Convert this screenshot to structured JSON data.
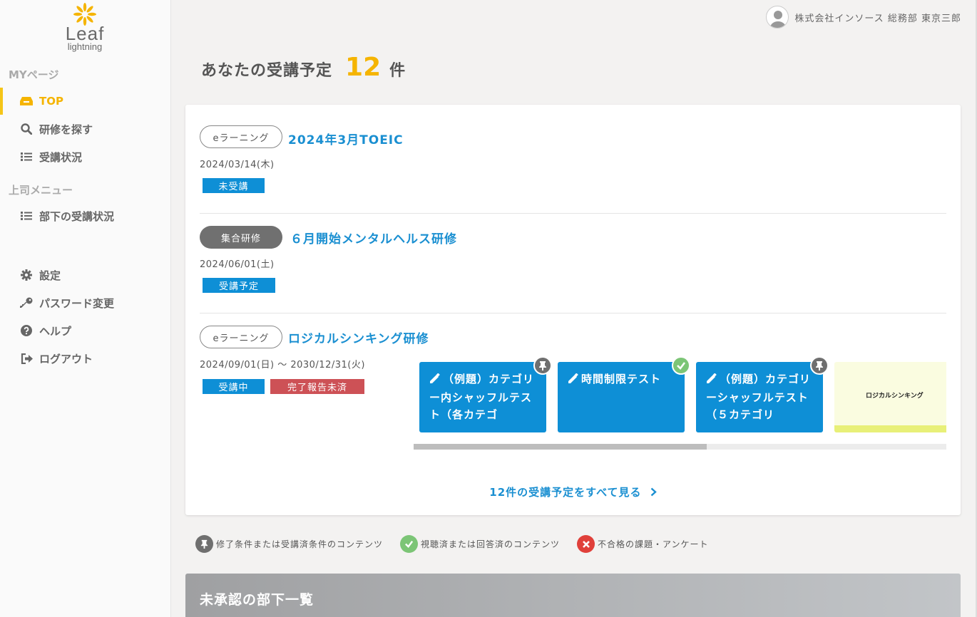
{
  "logo": {
    "name": "Leaf",
    "sub": "lightning"
  },
  "user": {
    "company": "株式会社インソース",
    "department": "総務部",
    "name": "東京三郎"
  },
  "sidebar": {
    "my_section": "MYページ",
    "my_items": [
      {
        "label": "TOP",
        "icon": "inbox-icon"
      },
      {
        "label": "研修を探す",
        "icon": "search-icon"
      },
      {
        "label": "受講状況",
        "icon": "list-icon"
      }
    ],
    "boss_section": "上司メニュー",
    "boss_items": [
      {
        "label": "部下の受講状況",
        "icon": "list-icon"
      }
    ],
    "other_items": [
      {
        "label": "設定",
        "icon": "gear-icon"
      },
      {
        "label": "パスワード変更",
        "icon": "key-icon"
      },
      {
        "label": "ヘルプ",
        "icon": "help-icon"
      },
      {
        "label": "ログアウト",
        "icon": "logout-icon"
      }
    ]
  },
  "heading": {
    "prefix": "あなたの受講予定",
    "count": "12",
    "suffix": "件"
  },
  "courses": [
    {
      "type": "eラーニング",
      "title": "2024年3月TOEIC",
      "date": "2024/03/14(木)",
      "badges": [
        "未受講"
      ]
    },
    {
      "type": "集合研修",
      "title": "６月開始メンタルヘルス研修",
      "date": "2024/06/01(土)",
      "badges": [
        "受講予定"
      ]
    },
    {
      "type": "eラーニング",
      "title": "ロジカルシンキング研修",
      "date": "2024/09/01(日) ～ 2030/12/31(火)",
      "badges": [
        "受講中",
        "完了報告未済"
      ],
      "contents": [
        {
          "text": "（例題）カテゴリー内シャッフルテスト（各カテゴ",
          "mark": "pin"
        },
        {
          "text": "時間制限テスト",
          "mark": "ok"
        },
        {
          "text": "（例題）カテゴリーシャッフルテスト（５カテゴリ",
          "mark": "pin"
        },
        {
          "text": "ロジカルシンキング"
        }
      ],
      "scroll_progress": 0.55
    }
  ],
  "see_all": "12件の受講予定をすべて見る",
  "legend": [
    {
      "text": "修了条件または受講済条件のコンテンツ",
      "color": "#6f6f6f"
    },
    {
      "text": "視聴済または回答済のコンテンツ",
      "color": "#7cc576"
    },
    {
      "text": "不合格の課題・アンケート",
      "color": "#e0403a"
    }
  ],
  "bottom_panel": {
    "title": "未承認の部下一覧"
  },
  "colors": {
    "accent": "#f5b400",
    "link": "#1a8fd1",
    "badge_blue": "#0e8fd6",
    "badge_red": "#cd5156"
  }
}
